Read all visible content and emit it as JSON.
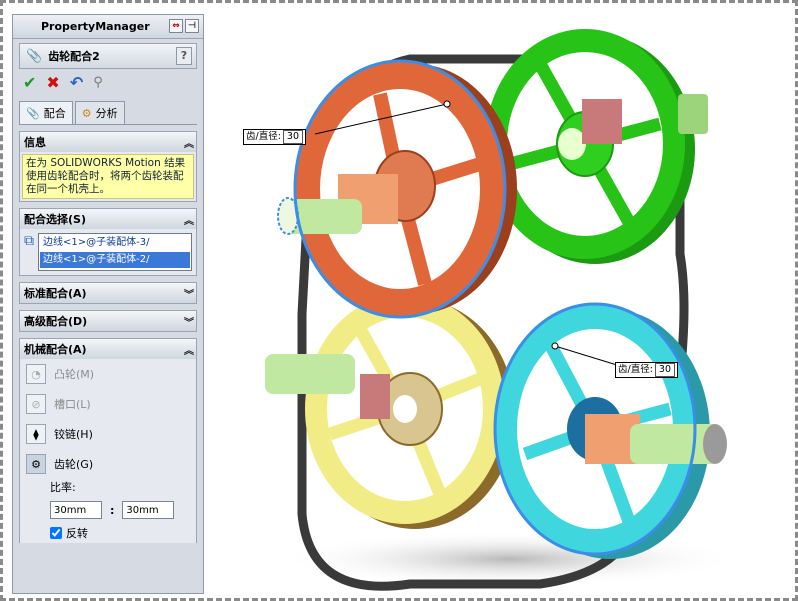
{
  "property_manager": {
    "title": "PropertyManager",
    "feature_name": "齿轮配合2",
    "help": "?",
    "tabs": [
      {
        "label": "配合"
      },
      {
        "label": "分析"
      }
    ],
    "info": {
      "title": "信息",
      "text": "在为 SOLIDWORKS Motion 结果使用齿轮配合时，将两个齿轮装配在同一个机壳上。"
    },
    "mate_selections": {
      "title": "配合选择(S)",
      "items": [
        "边线<1>@子装配体-3/",
        "边线<1>@子装配体-2/"
      ]
    },
    "standard_mates": {
      "title": "标准配合(A)"
    },
    "advanced_mates": {
      "title": "高级配合(D)"
    },
    "mechanical_mates": {
      "title": "机械配合(A)",
      "items": [
        {
          "label": "凸轮(M)",
          "icon": "cam-icon"
        },
        {
          "label": "槽口(L)",
          "icon": "slot-icon"
        },
        {
          "label": "铰链(H)",
          "icon": "hinge-icon"
        },
        {
          "label": "齿轮(G)",
          "icon": "gear-icon"
        }
      ],
      "ratio_label": "比率:",
      "ratio_left": "30mm",
      "ratio_sep": ":",
      "ratio_right": "30mm",
      "reverse_label": "反转",
      "reverse_checked": true
    }
  },
  "viewport": {
    "dim1": {
      "label": "齿/直径:",
      "value": "30"
    },
    "dim2": {
      "label": "齿/直径:",
      "value": "30"
    }
  },
  "colors": {
    "orange_wheel": "#e0673a",
    "green_wheel": "#27c417",
    "yellow_wheel": "#f2ec86",
    "cyan_wheel": "#3fd6de",
    "belt": "#3a3a3a",
    "highlight": "#3b8ee8"
  }
}
